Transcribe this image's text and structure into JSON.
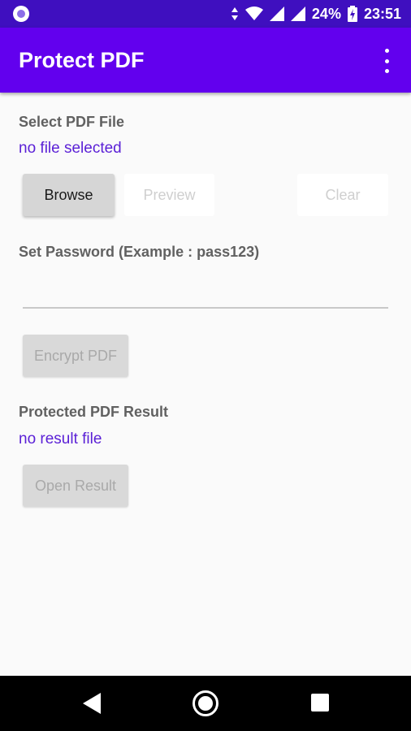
{
  "status_bar": {
    "battery_percent": "24%",
    "time": "23:51"
  },
  "app_bar": {
    "title": "Protect PDF"
  },
  "select_section": {
    "label": "Select PDF File",
    "file_status": "no file selected",
    "browse_label": "Browse",
    "preview_label": "Preview",
    "clear_label": "Clear"
  },
  "password_section": {
    "label": "Set Password (Example : pass123)",
    "value": ""
  },
  "encrypt_label": "Encrypt PDF",
  "result_section": {
    "label": "Protected PDF Result",
    "file_status": "no result file",
    "open_label": "Open Result"
  }
}
